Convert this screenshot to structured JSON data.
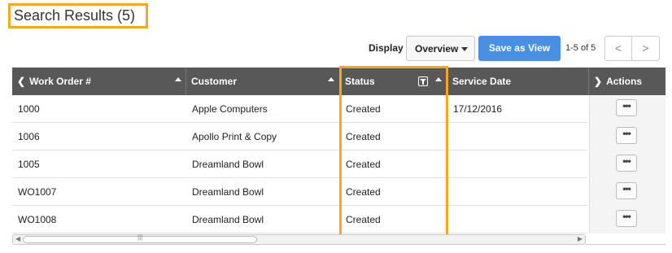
{
  "results": {
    "title": "Search Results (5)"
  },
  "toolbar": {
    "display_label": "Display",
    "display_value": "Overview",
    "save_view_label": "Save as View",
    "page_count": "1-5 of 5",
    "prev_glyph": "<",
    "next_glyph": ">"
  },
  "columns": {
    "work_order": "Work Order #",
    "customer": "Customer",
    "status": "Status",
    "service_date": "Service Date",
    "actions": "Actions"
  },
  "rows": [
    {
      "work_order": "1000",
      "customer": "Apple Computers",
      "status": "Created",
      "service_date": "17/12/2016"
    },
    {
      "work_order": "1006",
      "customer": "Apollo Print & Copy",
      "status": "Created",
      "service_date": ""
    },
    {
      "work_order": "1005",
      "customer": "Dreamland Bowl",
      "status": "Created",
      "service_date": ""
    },
    {
      "work_order": "WO1007",
      "customer": "Dreamland Bowl",
      "status": "Created",
      "service_date": ""
    },
    {
      "work_order": "WO1008",
      "customer": "Dreamland Bowl",
      "status": "Created",
      "service_date": ""
    }
  ],
  "actions_button": "•••",
  "colors": {
    "highlight": "#f5a623",
    "header_bg": "#585858",
    "primary": "#4a90e2"
  }
}
